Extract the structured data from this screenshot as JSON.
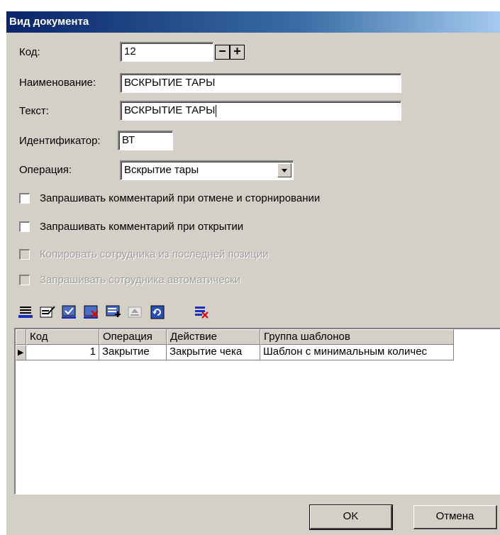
{
  "window": {
    "title": "Вид документа"
  },
  "form": {
    "code_label": "Код:",
    "code_value": "12",
    "spin_minus": "−",
    "spin_plus": "+",
    "name_label": "Наименование:",
    "name_value": "ВСКРЫТИЕ ТАРЫ",
    "text_label": "Текст:",
    "text_value": "ВСКРЫТИЕ ТАРЫ",
    "id_label": "Идентификатор:",
    "id_value": "ВТ",
    "operation_label": "Операция:",
    "operation_value": "Вскрытие тары"
  },
  "checkboxes": [
    {
      "label": "Запрашивать комментарий при отмене и сторнировании",
      "checked": false,
      "disabled": false
    },
    {
      "label": "Запрашивать комментарий при открытии",
      "checked": false,
      "disabled": false
    },
    {
      "label": "Копировать сотрудника из последней позиции",
      "checked": false,
      "disabled": true
    },
    {
      "label": "Запрашивать сотрудника автоматически",
      "checked": false,
      "disabled": true
    }
  ],
  "toolbar": {
    "icons": [
      "insert-row-icon",
      "edit-row-icon",
      "post-row-icon",
      "delete-row-icon",
      "add-row-icon",
      "up-row-icon",
      "refresh-icon",
      "cancel-row-icon"
    ]
  },
  "grid": {
    "columns": [
      "Код",
      "Операция",
      "Действие",
      "Группа шаблонов"
    ],
    "rows": [
      {
        "code": "1",
        "operation": "Закрытие",
        "action": "Закрытие чека",
        "template_group": "Шаблон с минимальным количес"
      }
    ],
    "current_row_marker": "▶"
  },
  "buttons": {
    "ok": "OK",
    "cancel": "Отмена"
  }
}
